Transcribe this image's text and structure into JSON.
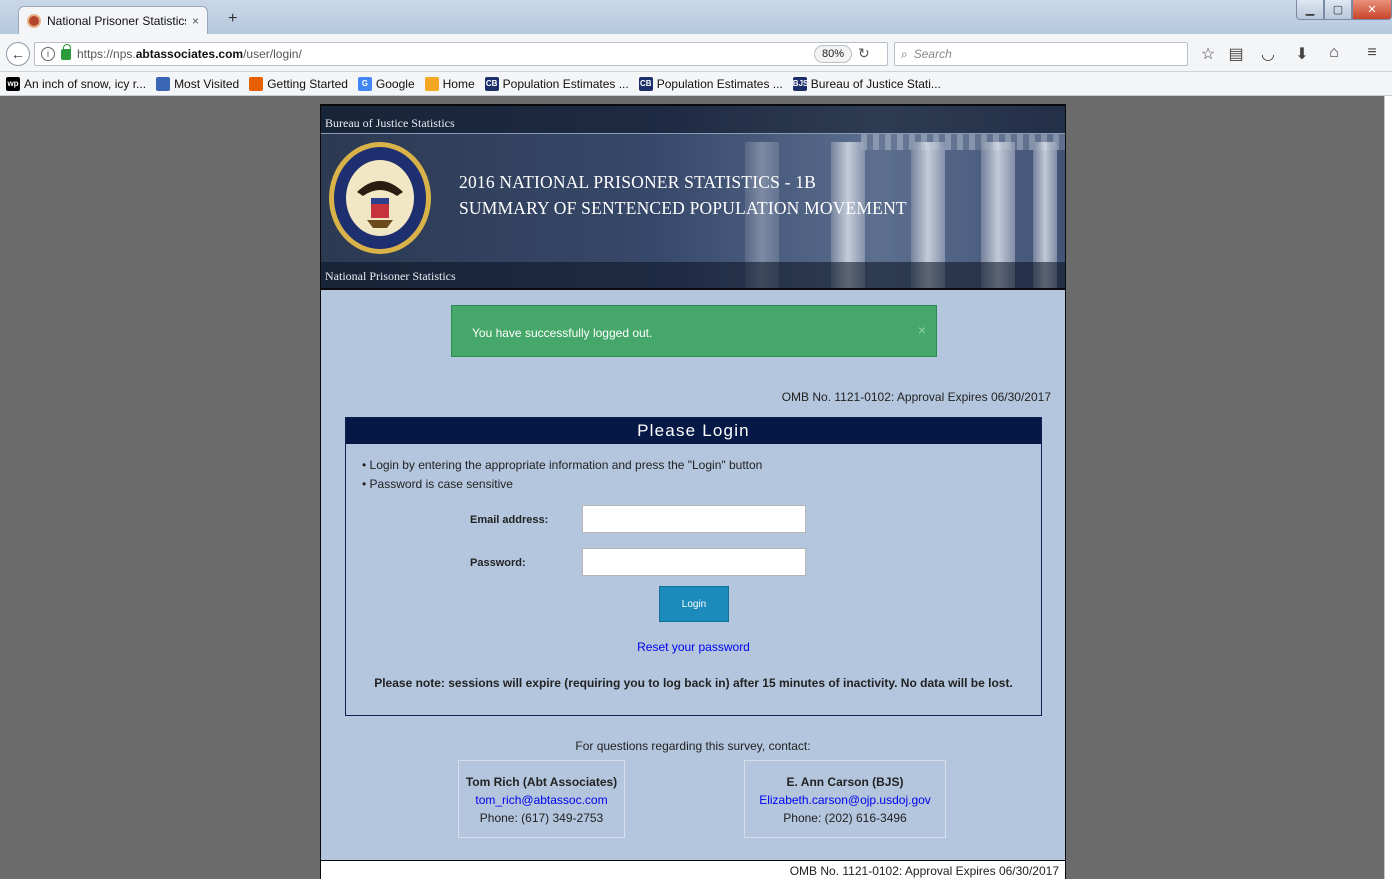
{
  "browser": {
    "tab_title": "National Prisoner Statistics ...",
    "tab_close": "×",
    "new_tab": "+",
    "url_prefix": "https://nps.",
    "url_domain": "abtassociates.com",
    "url_path": "/user/login/",
    "zoom": "80%",
    "search_placeholder": "Search",
    "bookmarks": [
      {
        "label": "An inch of snow, icy r...",
        "icon": "wp",
        "color": "#000000"
      },
      {
        "label": "Most Visited",
        "icon": "",
        "color": "#3a67b5"
      },
      {
        "label": "Getting Started",
        "icon": "",
        "color": "#e66000"
      },
      {
        "label": "Google",
        "icon": "G",
        "color": "#4285f4"
      },
      {
        "label": "Home",
        "icon": "",
        "color": "#f5a623"
      },
      {
        "label": "Population Estimates ...",
        "icon": "CB",
        "color": "#1c2f6b"
      },
      {
        "label": "Population Estimates ...",
        "icon": "CB",
        "color": "#1c2f6b"
      },
      {
        "label": "Bureau of Justice Stati...",
        "icon": "BJS",
        "color": "#1c2f6b"
      }
    ]
  },
  "banner": {
    "top_label": "Bureau of Justice Statistics",
    "title": "2016 NATIONAL PRISONER STATISTICS - 1B",
    "subtitle": "SUMMARY OF SENTENCED POPULATION MOVEMENT",
    "bottom_label": "National Prisoner Statistics"
  },
  "alert": {
    "message": "You have successfully logged out.",
    "close": "×"
  },
  "omb": "OMB No. 1121-0102: Approval Expires 06/30/2017",
  "login": {
    "heading": "Please Login",
    "bullets": [
      "Login by entering the appropriate information and press the \"Login\" button",
      "Password is case sensitive"
    ],
    "email_label": "Email address:",
    "email_value": "",
    "password_label": "Password:",
    "password_value": "",
    "button": "Login",
    "reset_link": "Reset your password",
    "note": "Please note: sessions will expire (requiring you to log back in) after 15 minutes of inactivity. No data will be lost."
  },
  "contacts": {
    "heading": "For questions regarding this survey, contact:",
    "people": [
      {
        "name": "Tom Rich (Abt Associates)",
        "email": "tom_rich@abtassoc.com",
        "phone": "Phone: (617) 349-2753"
      },
      {
        "name": "E. Ann Carson (BJS)",
        "email": "Elizabeth.carson@ojp.usdoj.gov",
        "phone": "Phone: (202) 616-3496"
      }
    ]
  },
  "footer": {
    "omb": "OMB No. 1121-0102: Approval Expires 06/30/2017"
  },
  "colors": {
    "page_bg": "#b4c6de",
    "login_header": "#061846",
    "alert_bg": "#45a86a",
    "button_bg": "#1b8bbb",
    "link": "#0000ee"
  }
}
